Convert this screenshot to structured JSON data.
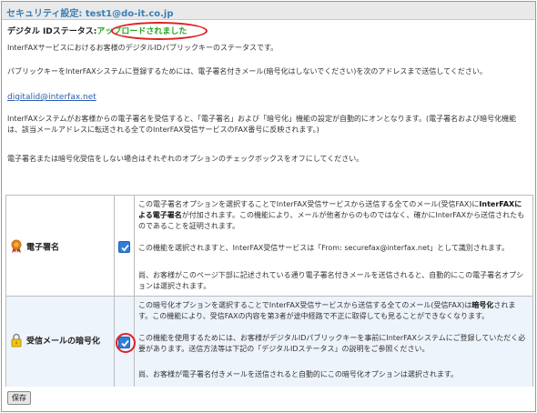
{
  "header": {
    "title": "セキュリティ設定: test1@do-it.co.jp"
  },
  "status": {
    "label": "デジタル IDステータス:",
    "value": "アップロードされました"
  },
  "info": {
    "p1": "InterFAXサービスにおけるお客様のデジタルIDパブリックキーのステータスです。",
    "p2": "パブリックキーをInterFAXシステムに登録するためには、電子署名付きメール(暗号化はしないでください)を次のアドレスまで送信してください。",
    "email": "digitalid@interfax.net",
    "p3": "InterFAXシステムがお客様からの電子署名を受信すると、「電子署名」および「暗号化」機能の設定が自動的にオンとなります。(電子署名および暗号化機能は、該当メールアドレスに転送される全てのInterFAX受信サービスのFAX番号に反映されます。)",
    "p4": "電子署名または暗号化受信をしない場合はそれぞれのオプションのチェックボックスをオフにしてください。"
  },
  "options": [
    {
      "label": "電子署名",
      "icon": "ribbon-icon",
      "checked": true,
      "desc1_pre": "この電子署名オプションを選択することでInterFAX受信サービスから送信する全てのメール(受信FAX)に",
      "desc1_bold": "InterFAXによる電子署名",
      "desc1_post": "が付加されます。この機能により、メールが他者からのものではなく、確かにInterFAXから送信されたものであることを証明されます。",
      "desc2": "この機能を選択されますと、InterFAX受信サービスは「From: securefax@interfax.net」として識別されます。",
      "desc3": "尚、お客様がこのページ下部に記述されている通り電子署名付きメールを送信されると、自動的にこの電子署名オプションは選択されます。"
    },
    {
      "label": "受信メールの暗号化",
      "icon": "padlock-icon",
      "checked": true,
      "desc1_pre": "この暗号化オプションを選択することでInterFAX受信サービスから送信する全てのメール(受信FAX)は",
      "desc1_bold": "暗号化",
      "desc1_post": "されます。この機能により、受信FAXの内容を第3者が途中経路で不正に取得しても見ることができなくなります。",
      "desc2": "この機能を使用するためには、お客様がデジタルIDパブリックキーを事前にInterFAXシステムにご登録していただく必要があります。送信方法等は下記の「デジタルIDステータス」の説明をご参照ください。",
      "desc3": "尚、お客様が電子署名付きメールを送信されると自動的にこの暗号化オプションは選択されます。"
    }
  ],
  "save_label": "保存",
  "colors": {
    "title": "#3a7fb5",
    "status": "#22a822",
    "annotation": "#e02020",
    "link": "#2a5db0",
    "checkbox": "#2f7fd8"
  }
}
